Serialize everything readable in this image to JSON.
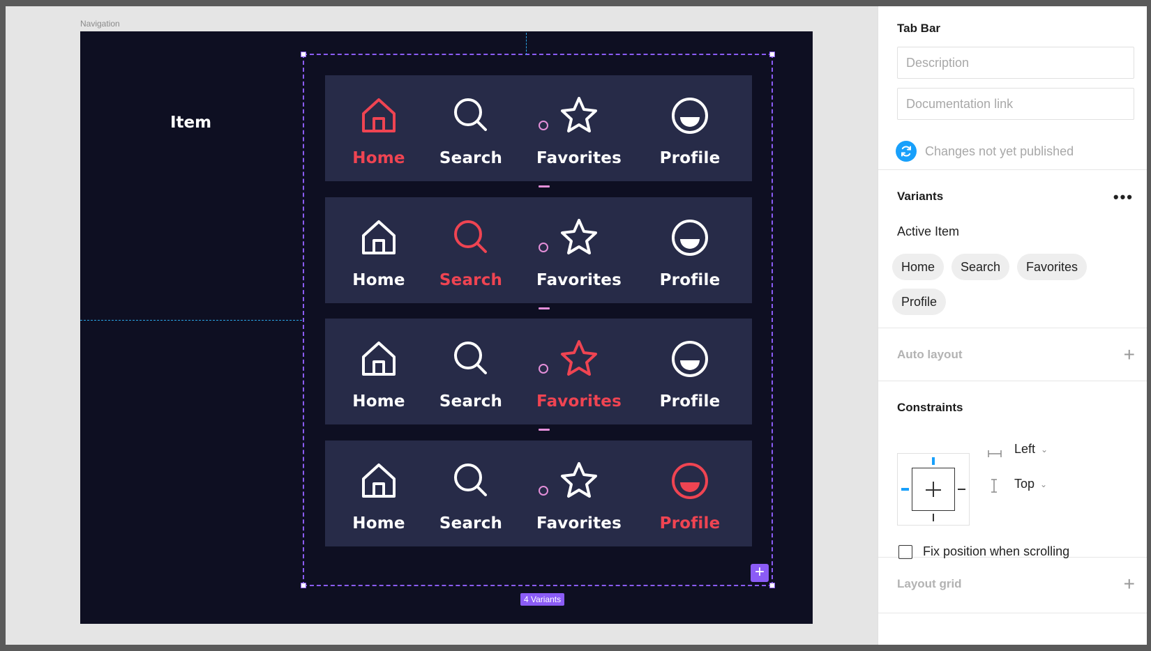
{
  "canvas": {
    "frame_label": "Navigation",
    "item_title": "Item",
    "variants_badge": "4 Variants",
    "add_variant_symbol": "+",
    "tabbars": [
      {
        "active": "home",
        "tabs": [
          {
            "id": "home",
            "label": "Home"
          },
          {
            "id": "search",
            "label": "Search"
          },
          {
            "id": "favorites",
            "label": "Favorites"
          },
          {
            "id": "profile",
            "label": "Profile"
          }
        ]
      },
      {
        "active": "search",
        "tabs": [
          {
            "id": "home",
            "label": "Home"
          },
          {
            "id": "search",
            "label": "Search"
          },
          {
            "id": "favorites",
            "label": "Favorites"
          },
          {
            "id": "profile",
            "label": "Profile"
          }
        ]
      },
      {
        "active": "favorites",
        "tabs": [
          {
            "id": "home",
            "label": "Home"
          },
          {
            "id": "search",
            "label": "Search"
          },
          {
            "id": "favorites",
            "label": "Favorites"
          },
          {
            "id": "profile",
            "label": "Profile"
          }
        ]
      },
      {
        "active": "profile",
        "tabs": [
          {
            "id": "home",
            "label": "Home"
          },
          {
            "id": "search",
            "label": "Search"
          },
          {
            "id": "favorites",
            "label": "Favorites"
          },
          {
            "id": "profile",
            "label": "Profile"
          }
        ]
      }
    ],
    "colors": {
      "frame_bg": "#0e0f22",
      "tabbar_bg": "#272b48",
      "active": "#ef4452",
      "inactive": "#ffffff",
      "selection": "#8b5cf6",
      "spacer": "#e48fd9"
    }
  },
  "panel": {
    "component_name": "Tab Bar",
    "description_placeholder": "Description",
    "doc_link_placeholder": "Documentation link",
    "publish_status": "Changes not yet published",
    "variants": {
      "title": "Variants",
      "more_label": "•••",
      "property_name": "Active Item",
      "options": [
        "Home",
        "Search",
        "Favorites",
        "Profile"
      ]
    },
    "auto_layout": {
      "title": "Auto layout",
      "add_symbol": "+"
    },
    "constraints": {
      "title": "Constraints",
      "horizontal": "Left",
      "vertical": "Top",
      "fix_position_label": "Fix position when scrolling",
      "fix_position_checked": false
    },
    "layout_grid": {
      "title": "Layout grid",
      "add_symbol": "+"
    }
  }
}
